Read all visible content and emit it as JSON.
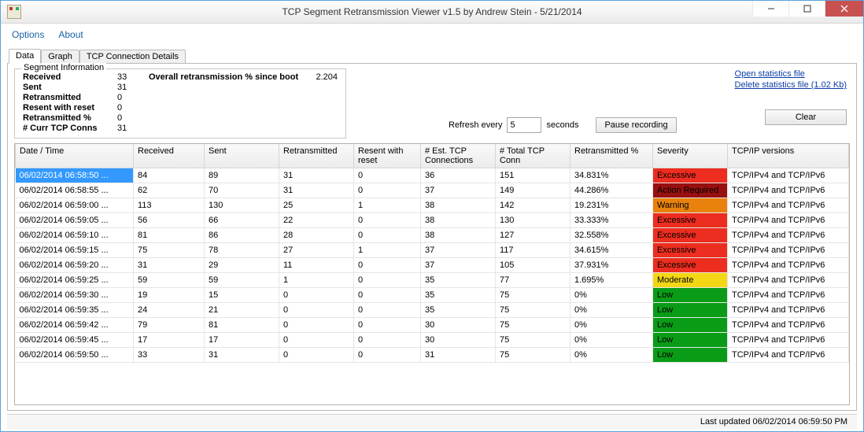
{
  "window": {
    "title": "TCP Segment Retransmission Viewer v1.5 by Andrew Stein - 5/21/2014"
  },
  "menu": {
    "options": "Options",
    "about": "About"
  },
  "tabs": {
    "data": "Data",
    "graph": "Graph",
    "details": "TCP Connection Details"
  },
  "segment_info": {
    "title": "Segment Information",
    "received_lbl": "Received",
    "received": "33",
    "sent_lbl": "Sent",
    "sent": "31",
    "retransmitted_lbl": "Retransmitted",
    "retransmitted": "0",
    "resent_reset_lbl": "Resent with reset",
    "resent_reset": "0",
    "retrans_pct_lbl": "Retransmitted %",
    "retrans_pct": "0",
    "curr_conns_lbl": "# Curr TCP Conns",
    "curr_conns": "31",
    "overall_lbl": "Overall retransmission % since boot",
    "overall_val": "2.204"
  },
  "controls": {
    "refresh_lbl": "Refresh every",
    "refresh_value": "5",
    "refresh_unit": "seconds",
    "pause": "Pause recording",
    "clear": "Clear"
  },
  "links": {
    "open": "Open statistics file",
    "delete": "Delete statistics file (1.02 Kb)"
  },
  "table": {
    "headers": {
      "datetime": "Date / Time",
      "received": "Received",
      "sent": "Sent",
      "retransmitted": "Retransmitted",
      "resent_reset": "Resent with reset",
      "est": "# Est. TCP Connections",
      "total": "# Total TCP Conn",
      "retrans_pct": "Retransmitted %",
      "severity": "Severity",
      "versions": "TCP/IP versions"
    },
    "rows": [
      {
        "dt": "06/02/2014 06:58:50 ...",
        "recv": "84",
        "sent": "89",
        "ret": "31",
        "rwr": "0",
        "est": "36",
        "tot": "151",
        "pct": "34.831%",
        "sev": "Excessive",
        "sev_cls": "sev-excessive",
        "ver": "TCP/IPv4 and TCP/IPv6"
      },
      {
        "dt": "06/02/2014 06:58:55 ...",
        "recv": "62",
        "sent": "70",
        "ret": "31",
        "rwr": "0",
        "est": "37",
        "tot": "149",
        "pct": "44.286%",
        "sev": "Action Required",
        "sev_cls": "sev-action",
        "ver": "TCP/IPv4 and TCP/IPv6"
      },
      {
        "dt": "06/02/2014 06:59:00 ...",
        "recv": "113",
        "sent": "130",
        "ret": "25",
        "rwr": "1",
        "est": "38",
        "tot": "142",
        "pct": "19.231%",
        "sev": "Warning",
        "sev_cls": "sev-warning",
        "ver": "TCP/IPv4 and TCP/IPv6"
      },
      {
        "dt": "06/02/2014 06:59:05 ...",
        "recv": "56",
        "sent": "66",
        "ret": "22",
        "rwr": "0",
        "est": "38",
        "tot": "130",
        "pct": "33.333%",
        "sev": "Excessive",
        "sev_cls": "sev-excessive",
        "ver": "TCP/IPv4 and TCP/IPv6"
      },
      {
        "dt": "06/02/2014 06:59:10 ...",
        "recv": "81",
        "sent": "86",
        "ret": "28",
        "rwr": "0",
        "est": "38",
        "tot": "127",
        "pct": "32.558%",
        "sev": "Excessive",
        "sev_cls": "sev-excessive",
        "ver": "TCP/IPv4 and TCP/IPv6"
      },
      {
        "dt": "06/02/2014 06:59:15 ...",
        "recv": "75",
        "sent": "78",
        "ret": "27",
        "rwr": "1",
        "est": "37",
        "tot": "117",
        "pct": "34.615%",
        "sev": "Excessive",
        "sev_cls": "sev-excessive",
        "ver": "TCP/IPv4 and TCP/IPv6"
      },
      {
        "dt": "06/02/2014 06:59:20 ...",
        "recv": "31",
        "sent": "29",
        "ret": "11",
        "rwr": "0",
        "est": "37",
        "tot": "105",
        "pct": "37.931%",
        "sev": "Excessive",
        "sev_cls": "sev-excessive",
        "ver": "TCP/IPv4 and TCP/IPv6"
      },
      {
        "dt": "06/02/2014 06:59:25 ...",
        "recv": "59",
        "sent": "59",
        "ret": "1",
        "rwr": "0",
        "est": "35",
        "tot": "77",
        "pct": "1.695%",
        "sev": "Moderate",
        "sev_cls": "sev-moderate",
        "ver": "TCP/IPv4 and TCP/IPv6"
      },
      {
        "dt": "06/02/2014 06:59:30 ...",
        "recv": "19",
        "sent": "15",
        "ret": "0",
        "rwr": "0",
        "est": "35",
        "tot": "75",
        "pct": "0%",
        "sev": "Low",
        "sev_cls": "sev-low",
        "ver": "TCP/IPv4 and TCP/IPv6"
      },
      {
        "dt": "06/02/2014 06:59:35 ...",
        "recv": "24",
        "sent": "21",
        "ret": "0",
        "rwr": "0",
        "est": "35",
        "tot": "75",
        "pct": "0%",
        "sev": "Low",
        "sev_cls": "sev-low",
        "ver": "TCP/IPv4 and TCP/IPv6"
      },
      {
        "dt": "06/02/2014 06:59:42 ...",
        "recv": "79",
        "sent": "81",
        "ret": "0",
        "rwr": "0",
        "est": "30",
        "tot": "75",
        "pct": "0%",
        "sev": "Low",
        "sev_cls": "sev-low",
        "ver": "TCP/IPv4 and TCP/IPv6"
      },
      {
        "dt": "06/02/2014 06:59:45 ...",
        "recv": "17",
        "sent": "17",
        "ret": "0",
        "rwr": "0",
        "est": "30",
        "tot": "75",
        "pct": "0%",
        "sev": "Low",
        "sev_cls": "sev-low",
        "ver": "TCP/IPv4 and TCP/IPv6"
      },
      {
        "dt": "06/02/2014 06:59:50 ...",
        "recv": "33",
        "sent": "31",
        "ret": "0",
        "rwr": "0",
        "est": "31",
        "tot": "75",
        "pct": "0%",
        "sev": "Low",
        "sev_cls": "sev-low",
        "ver": "TCP/IPv4 and TCP/IPv6"
      }
    ]
  },
  "status": {
    "last_updated": "Last updated 06/02/2014 06:59:50 PM"
  }
}
